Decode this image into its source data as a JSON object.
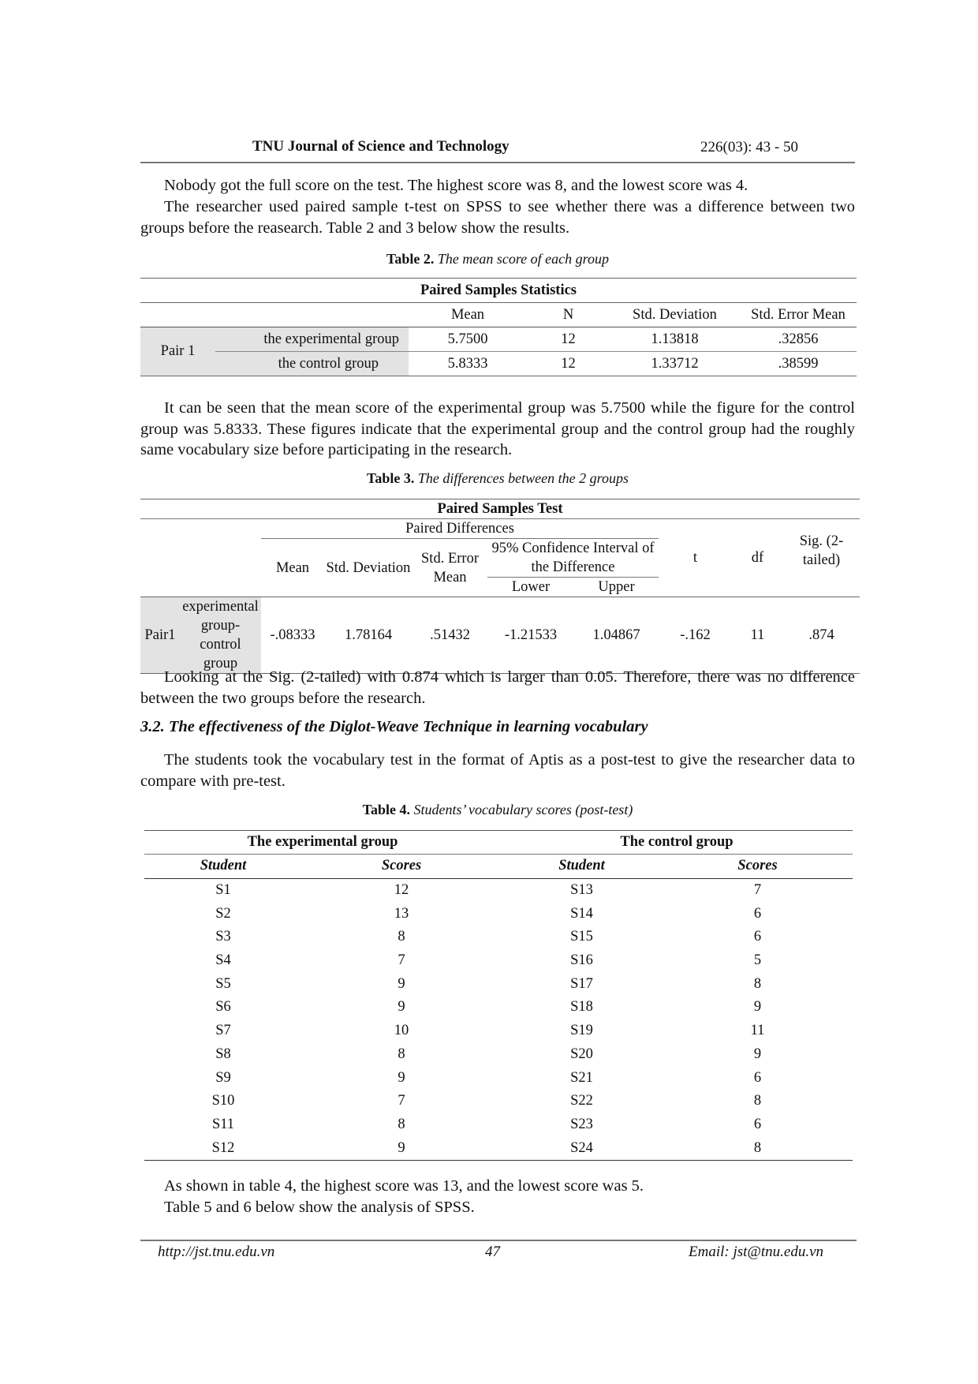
{
  "header": {
    "journal_title": "TNU Journal of Science and Technology",
    "issue": "226(03): 43 - 50"
  },
  "paragraphs": {
    "p1": "Nobody got the full score on the test. The highest score was 8, and the lowest score was 4.",
    "p2": "The researcher used paired sample t-test on SPSS to see whether there was a difference between two groups before the reasearch. Table 2 and 3 below show the results.",
    "p3": "It can be seen that the mean score of the experimental group was 5.7500 while the figure for the control group was 5.8333. These figures indicate that the experimental group and the control group had the roughly same vocabulary size before participating in the research.",
    "p4": "Looking at the Sig. (2-tailed) with 0.874 which is larger than 0.05. Therefore, there was no difference between the two groups before the research.",
    "p5": "The students took the vocabulary test in the format of Aptis as a post-test to give the researcher data to compare with pre-test.",
    "p6": "As shown in table 4, the highest score was 13, and the lowest score was 5.",
    "p7": "Table 5 and 6 below show the analysis of SPSS."
  },
  "section_heading": "3.2. The effectiveness of the Diglot-Weave Technique in learning vocabulary",
  "table2": {
    "caption_label": "Table 2.",
    "caption_text": "The mean score of each group",
    "title": "Paired Samples Statistics",
    "columns": [
      "Mean",
      "N",
      "Std. Deviation",
      "Std. Error Mean"
    ],
    "pair_label": "Pair 1",
    "rows": [
      {
        "group": "the experimental group",
        "mean": "5.7500",
        "n": "12",
        "sd": "1.13818",
        "sem": ".32856"
      },
      {
        "group": "the control group",
        "mean": "5.8333",
        "n": "12",
        "sd": "1.33712",
        "sem": ".38599"
      }
    ]
  },
  "table3": {
    "caption_label": "Table 3.",
    "caption_text": "The differences between the 2 groups",
    "title": "Paired Samples Test",
    "paired_differences": "Paired Differences",
    "col_mean": "Mean",
    "col_sd": "Std. Deviation",
    "col_sem": "Std. Error Mean",
    "col_ci": "95% Confidence Interval of the Difference",
    "col_lower": "Lower",
    "col_upper": "Upper",
    "col_t": "t",
    "col_df": "df",
    "col_sig": "Sig. (2-tailed)",
    "row": {
      "pair": "Pair1",
      "label": "experimental group- control group",
      "mean": "-.08333",
      "sd": "1.78164",
      "sem": ".51432",
      "lower": "-1.21533",
      "upper": "1.04867",
      "t": "-.162",
      "df": "11",
      "sig": ".874"
    }
  },
  "table4": {
    "caption_label": "Table 4.",
    "caption_text": "Students’ vocabulary scores (post-test)",
    "group_left": "The experimental group",
    "group_right": "The control group",
    "col_student": "Student",
    "col_scores": "Scores",
    "rows": [
      {
        "s1": "S1",
        "v1": "12",
        "s2": "S13",
        "v2": "7"
      },
      {
        "s1": "S2",
        "v1": "13",
        "s2": "S14",
        "v2": "6"
      },
      {
        "s1": "S3",
        "v1": "8",
        "s2": "S15",
        "v2": "6"
      },
      {
        "s1": "S4",
        "v1": "7",
        "s2": "S16",
        "v2": "5"
      },
      {
        "s1": "S5",
        "v1": "9",
        "s2": "S17",
        "v2": "8"
      },
      {
        "s1": "S6",
        "v1": "9",
        "s2": "S18",
        "v2": "9"
      },
      {
        "s1": "S7",
        "v1": "10",
        "s2": "S19",
        "v2": "11"
      },
      {
        "s1": "S8",
        "v1": "8",
        "s2": "S20",
        "v2": "9"
      },
      {
        "s1": "S9",
        "v1": "9",
        "s2": "S21",
        "v2": "6"
      },
      {
        "s1": "S10",
        "v1": "7",
        "s2": "S22",
        "v2": "8"
      },
      {
        "s1": "S11",
        "v1": "8",
        "s2": "S23",
        "v2": "6"
      },
      {
        "s1": "S12",
        "v1": "9",
        "s2": "S24",
        "v2": "8"
      }
    ]
  },
  "footer": {
    "url": "http://jst.tnu.edu.vn",
    "page_number": "47",
    "email": "Email: jst@tnu.edu.vn"
  }
}
